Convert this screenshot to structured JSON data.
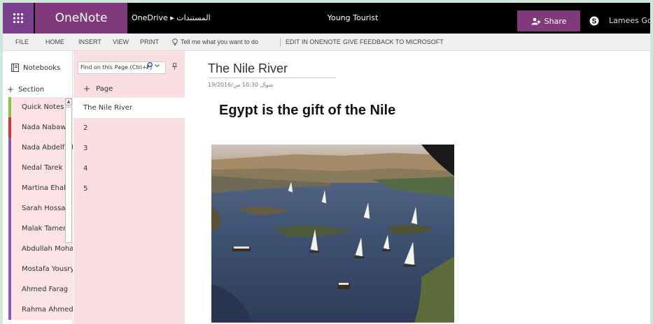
{
  "app": {
    "name": "OneNote Online",
    "breadcrumb": "OneDrive ▸ المستندات",
    "document_title": "Young Tourist",
    "share_label": "Share",
    "user_name": "Lamees Gouda"
  },
  "ribbon": {
    "tabs": [
      "FILE",
      "HOME",
      "INSERT",
      "VIEW",
      "PRINT"
    ],
    "tell_me": "Tell me what you want to do",
    "edit_in_onenote": "EDIT IN ONENOTE",
    "feedback": "GIVE FEEDBACK TO MICROSOFT"
  },
  "notebook": {
    "header": "Notebooks",
    "add_section": "Section",
    "sections": [
      {
        "label": "Quick Notes",
        "color": "#8bc34a"
      },
      {
        "label": "Nada Nabawy",
        "color": "#d13438"
      },
      {
        "label": "Nada Abdelfattah",
        "color": "#8a5cb5"
      },
      {
        "label": "Nedal Tarek",
        "color": "#8a5cb5"
      },
      {
        "label": "Martina Ehab",
        "color": "#8a5cb5"
      },
      {
        "label": "Sarah Hossam",
        "color": "#8a5cb5"
      },
      {
        "label": "Malak Tamer",
        "color": "#8a5cb5"
      },
      {
        "label": "Abdullah Mohamed",
        "color": "#8a5cb5"
      },
      {
        "label": "Mostafa Yousry",
        "color": "#8a5cb5"
      },
      {
        "label": "Ahmed Farag",
        "color": "#8a5cb5"
      },
      {
        "label": "Rahma Ahmed",
        "color": "#8a5cb5"
      }
    ]
  },
  "pages": {
    "search_placeholder": "Find on this Page (Ctrl+F)",
    "add_page": "Page",
    "items": [
      "The Nile River",
      "2",
      "3",
      "4",
      "5"
    ],
    "active_index": 0
  },
  "page": {
    "title": "The Nile River",
    "date": "19/2016/شوال  10:30 من",
    "heading": "Egypt is the gift of the Nile"
  },
  "colors": {
    "brand_purple": "#80397b",
    "section_pink": "#fbe3e5",
    "page_pane_pink": "#f9dfe1"
  }
}
